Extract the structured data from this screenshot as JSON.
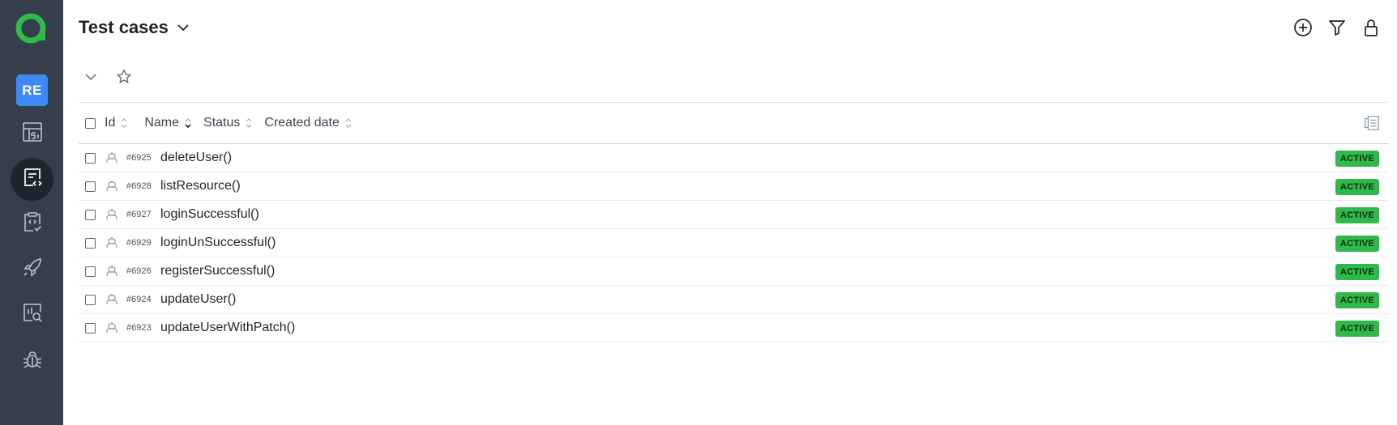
{
  "sidebar": {
    "project_badge": "RE",
    "items": [
      {
        "name": "dashboards",
        "icon": "dashboard-icon"
      },
      {
        "name": "test-cases",
        "icon": "test-cases-icon",
        "active": true
      },
      {
        "name": "test-plans",
        "icon": "test-plans-icon"
      },
      {
        "name": "launches",
        "icon": "rocket-icon"
      },
      {
        "name": "analytics",
        "icon": "analytics-search-icon"
      },
      {
        "name": "defects",
        "icon": "bug-icon"
      }
    ]
  },
  "header": {
    "title": "Test cases",
    "actions": [
      "add-icon",
      "filter-icon",
      "lock-icon"
    ]
  },
  "table": {
    "columns": {
      "id": "Id",
      "name": "Name",
      "status": "Status",
      "created": "Created date"
    },
    "rows": [
      {
        "id": "#6925",
        "name": "deleteUser()",
        "status": "ACTIVE"
      },
      {
        "id": "#6928",
        "name": "listResource()",
        "status": "ACTIVE"
      },
      {
        "id": "#6927",
        "name": "loginSuccessful()",
        "status": "ACTIVE"
      },
      {
        "id": "#6929",
        "name": "loginUnSuccessful()",
        "status": "ACTIVE"
      },
      {
        "id": "#6926",
        "name": "registerSuccessful()",
        "status": "ACTIVE"
      },
      {
        "id": "#6924",
        "name": "updateUser()",
        "status": "ACTIVE"
      },
      {
        "id": "#6923",
        "name": "updateUserWithPatch()",
        "status": "ACTIVE"
      }
    ]
  },
  "colors": {
    "sidebar_bg": "#343f4b",
    "active_nav_bg": "#1c2530",
    "project_badge_bg": "#3d8af7",
    "logo_green": "#2fb94a",
    "status_active": "#2fb94a"
  }
}
